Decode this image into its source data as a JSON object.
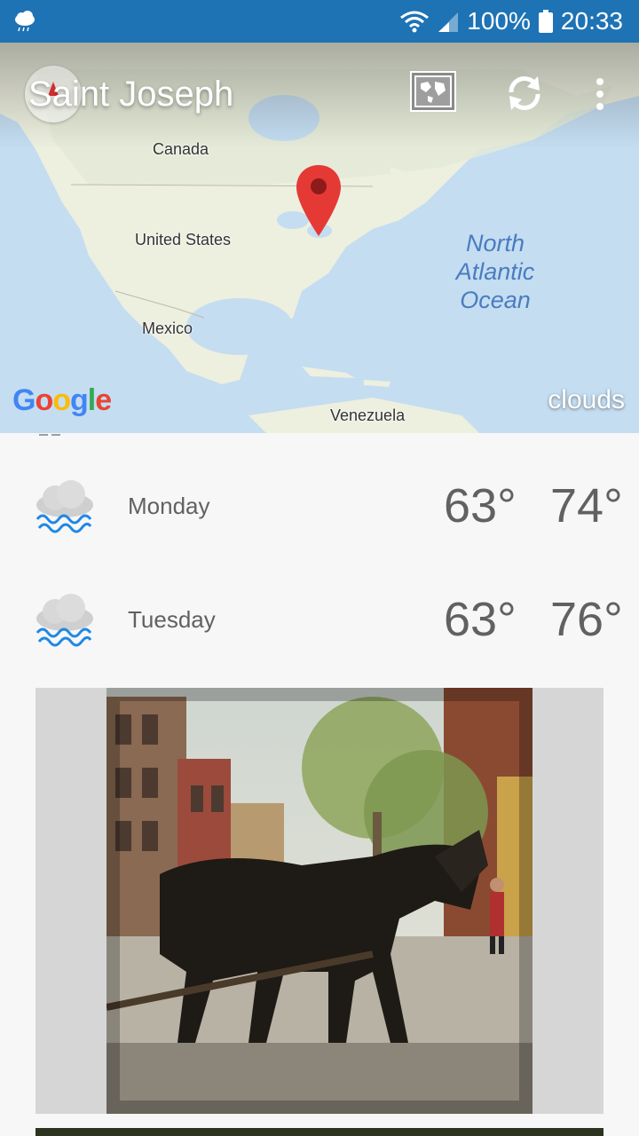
{
  "status_bar": {
    "battery": "100%",
    "time": "20:33"
  },
  "header": {
    "city": "Saint Joseph"
  },
  "map": {
    "labels": {
      "canada": "Canada",
      "united_states": "United States",
      "mexico": "Mexico",
      "venezuela": "Venezuela",
      "ocean_line1": "North",
      "ocean_line2": "Atlantic",
      "ocean_line3": "Ocean"
    },
    "provider": "Google",
    "layer": "clouds"
  },
  "forecast": [
    {
      "day": "Monday",
      "min": "63°",
      "max": "74°",
      "icon": "rain-cloud-icon"
    },
    {
      "day": "Tuesday",
      "min": "63°",
      "max": "76°",
      "icon": "rain-cloud-icon"
    }
  ],
  "colors": {
    "status_bar": "#1e73b5",
    "pin": "#e53935",
    "rain": "#1e88e5"
  }
}
